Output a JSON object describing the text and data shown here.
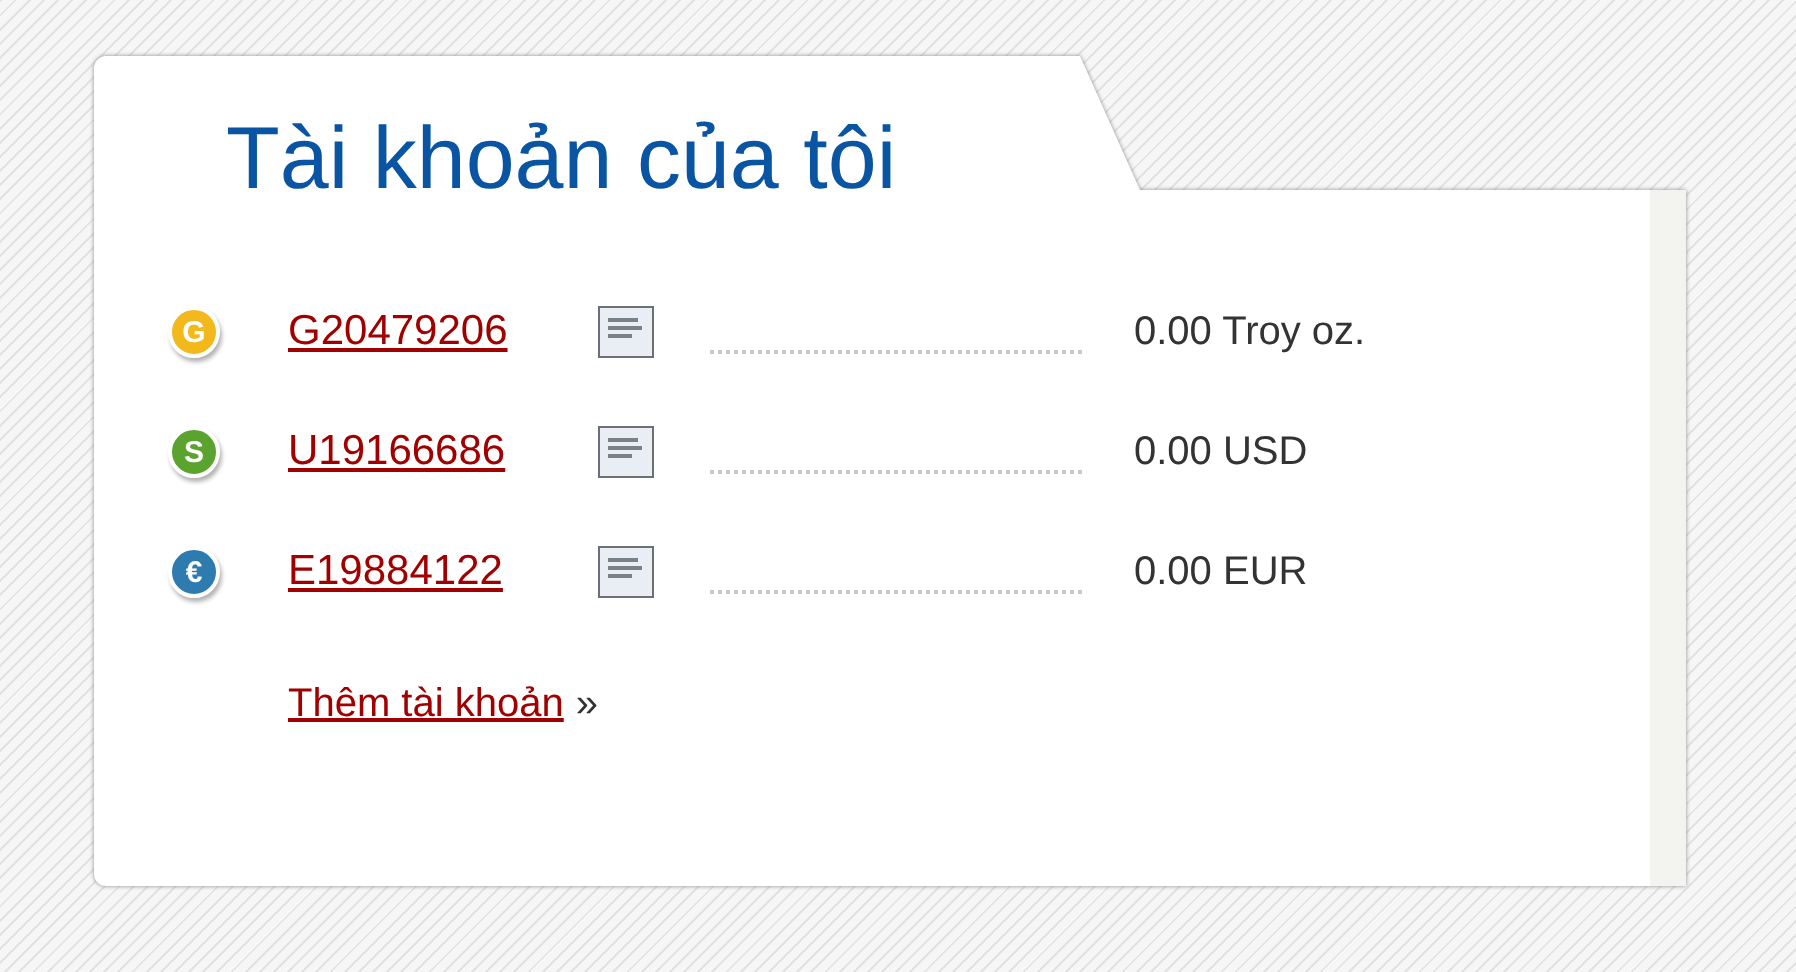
{
  "title": "Tài khoản của tôi",
  "accounts": [
    {
      "symbol": "G",
      "color": "#f2b81c",
      "number": "G20479206",
      "balance": "0.00 Troy oz."
    },
    {
      "symbol": "S",
      "color": "#5aa32f",
      "number": "U19166686",
      "balance": "0.00 USD"
    },
    {
      "symbol": "€",
      "color": "#2e7bb0",
      "number": "E19884122",
      "balance": "0.00 EUR"
    }
  ],
  "add_account": {
    "label": "Thêm tài khoản",
    "suffix": "»"
  }
}
